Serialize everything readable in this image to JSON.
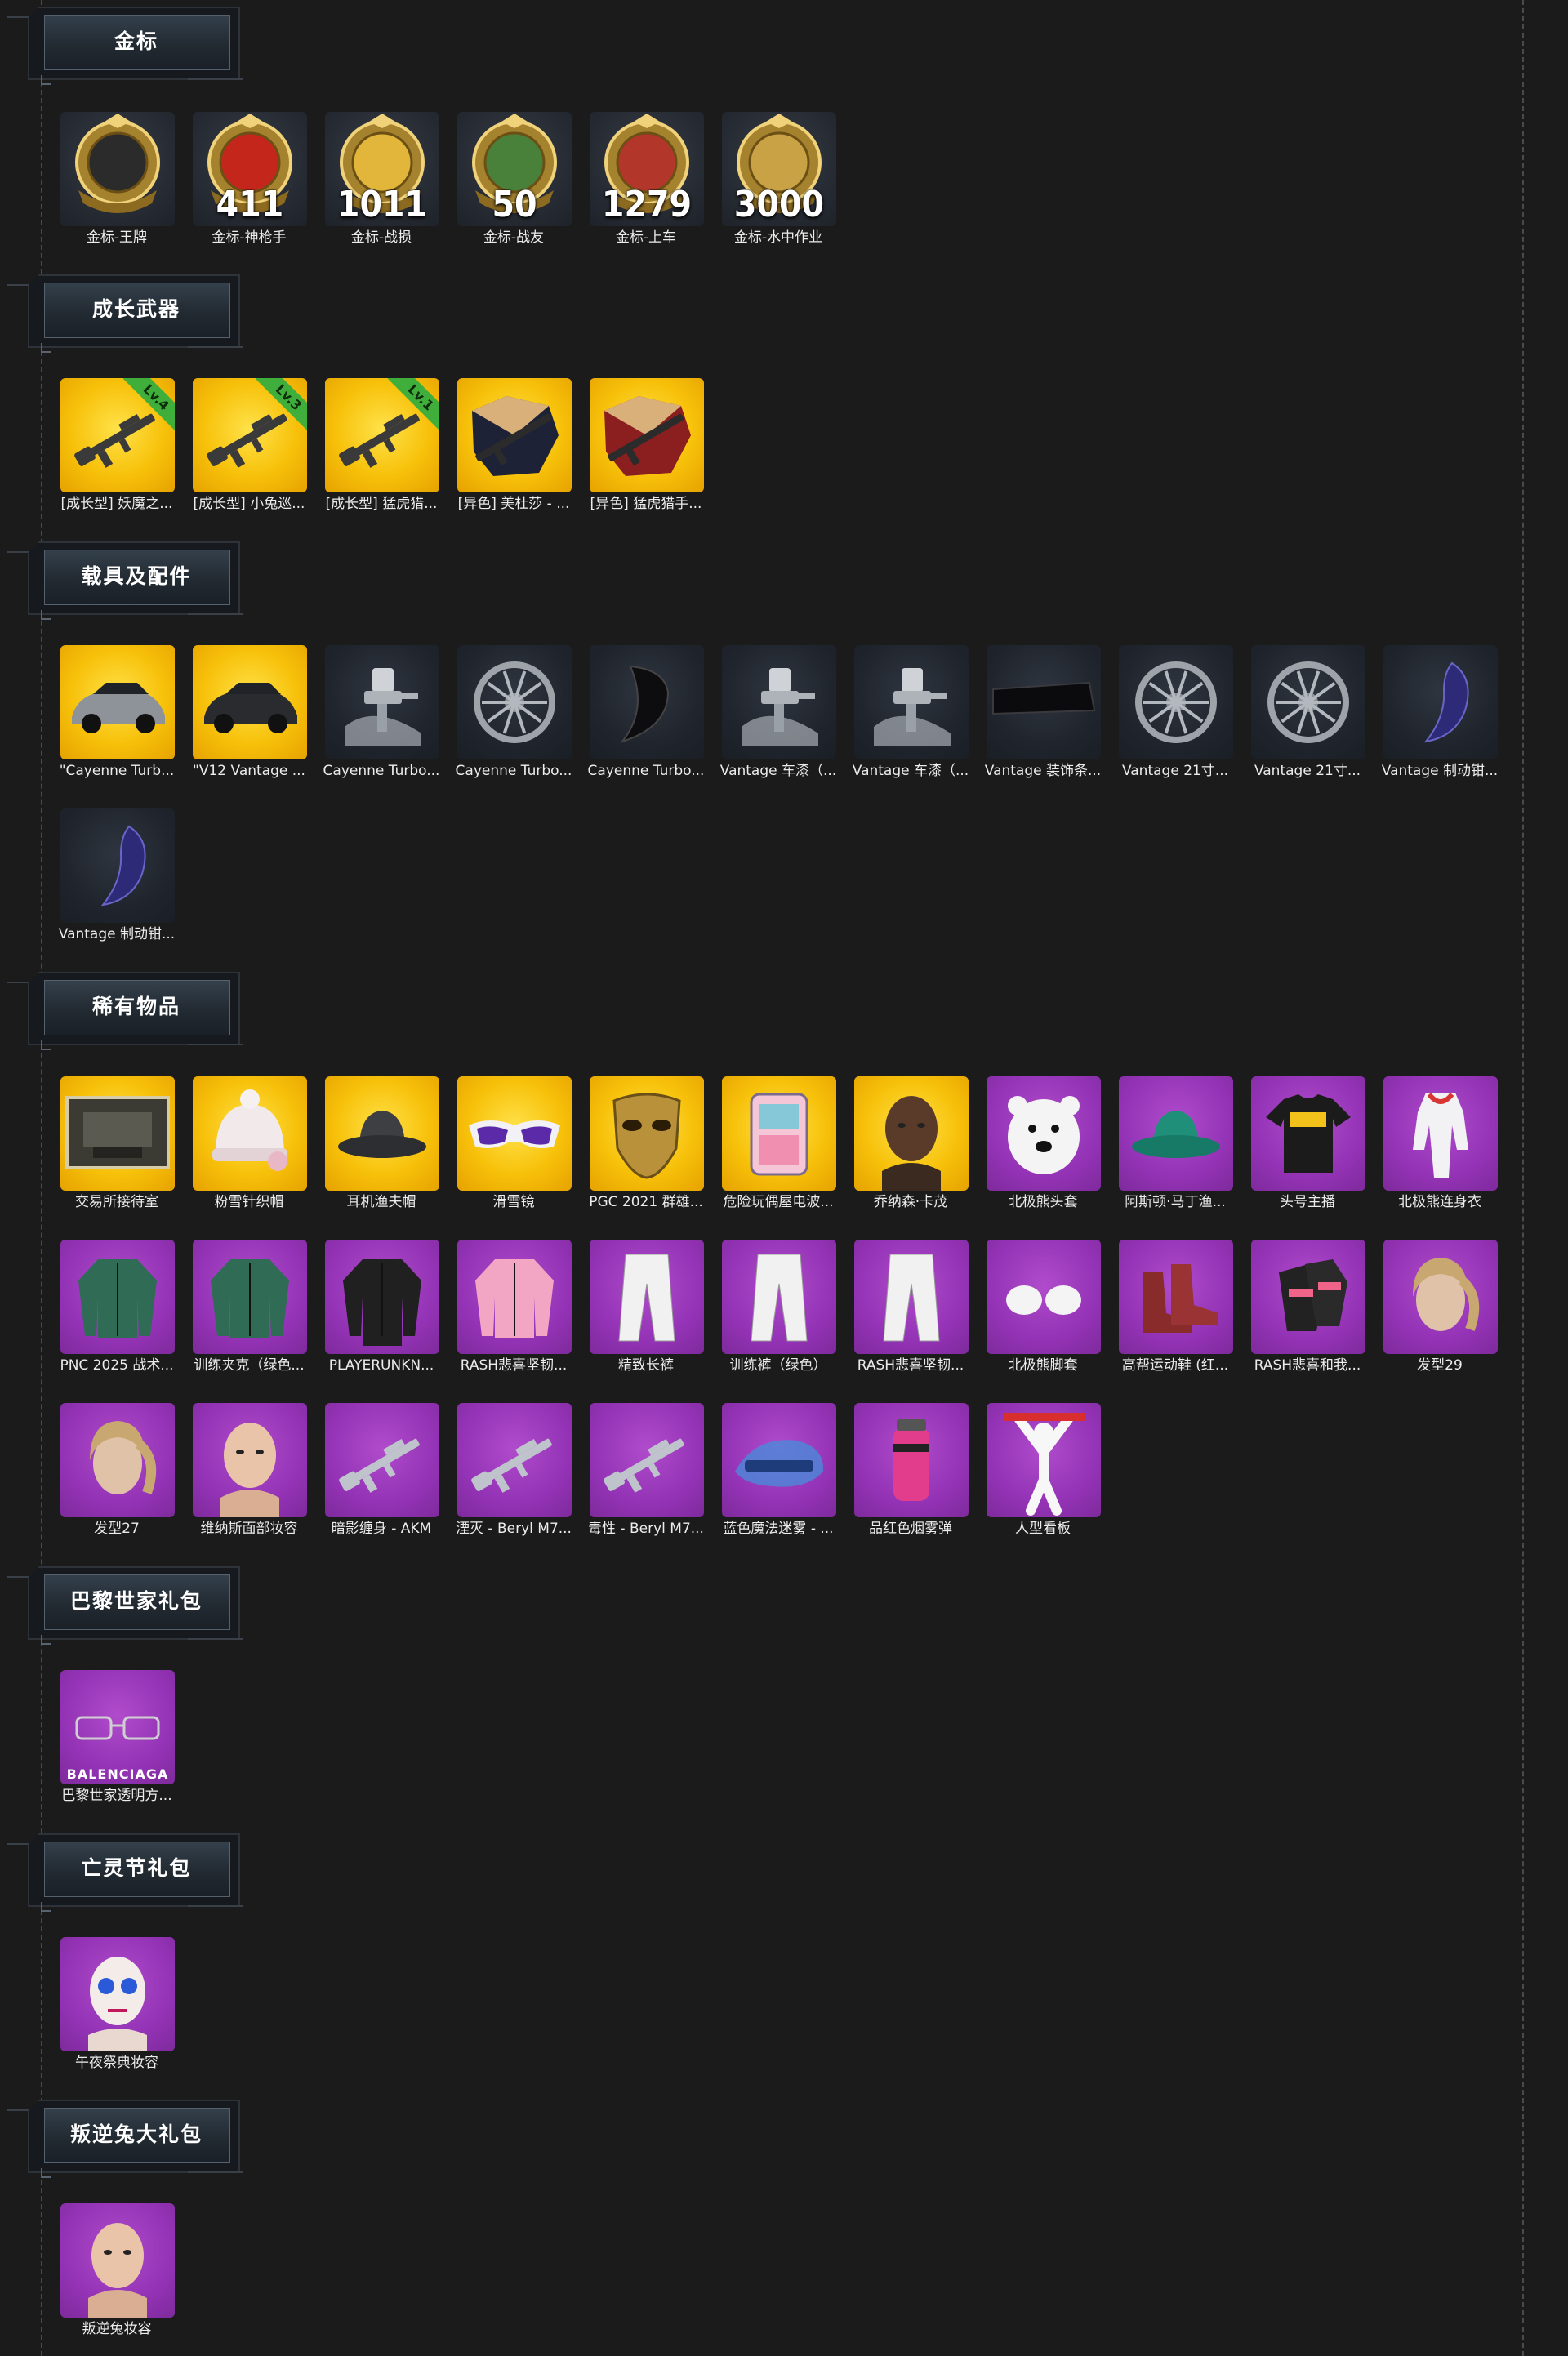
{
  "sections": [
    {
      "title": "金标",
      "items": [
        {
          "label": "金标-王牌",
          "icon": "ace-emblem-icon",
          "tile": "emblem",
          "value": ""
        },
        {
          "label": "金标-神枪手",
          "icon": "sharpshooter-emblem-icon",
          "tile": "emblem",
          "value": "411"
        },
        {
          "label": "金标-战损",
          "icon": "battle-damage-emblem-icon",
          "tile": "emblem",
          "value": "1011"
        },
        {
          "label": "金标-战友",
          "icon": "comrade-emblem-icon",
          "tile": "emblem",
          "value": "50"
        },
        {
          "label": "金标-上车",
          "icon": "car-emblem-icon",
          "tile": "emblem",
          "value": "1279"
        },
        {
          "label": "金标-水中作业",
          "icon": "seal-emblem-icon",
          "tile": "emblem",
          "value": "3000"
        }
      ]
    },
    {
      "title": "成长武器",
      "items": [
        {
          "label": "[成长型] 妖魔之...",
          "icon": "rifle-icon",
          "tile": "gold",
          "level": "Lv.4"
        },
        {
          "label": "[成长型] 小兔巡...",
          "icon": "rifle-icon",
          "tile": "gold",
          "level": "Lv.3"
        },
        {
          "label": "[成长型] 猛虎猎...",
          "icon": "shotgun-icon",
          "tile": "gold",
          "level": "Lv.1"
        },
        {
          "label": "[异色] 美杜莎 - ...",
          "icon": "rifle-map-icon",
          "tile": "gold"
        },
        {
          "label": "[异色] 猛虎猎手...",
          "icon": "shotgun-map-icon",
          "tile": "gold"
        }
      ]
    },
    {
      "title": "载具及配件",
      "items": [
        {
          "label": "\"Cayenne Turb...",
          "icon": "suv-car-icon",
          "tile": "gold"
        },
        {
          "label": "\"V12 Vantage ...",
          "icon": "sports-car-icon",
          "tile": "gold"
        },
        {
          "label": "Cayenne Turbo...",
          "icon": "spray-gun-icon",
          "tile": "dark"
        },
        {
          "label": "Cayenne Turbo...",
          "icon": "wheel-rim-icon",
          "tile": "dark"
        },
        {
          "label": "Cayenne Turbo...",
          "icon": "car-trim-icon",
          "tile": "dark"
        },
        {
          "label": "Vantage 车漆（...",
          "icon": "spray-gun-icon",
          "tile": "dark"
        },
        {
          "label": "Vantage 车漆（...",
          "icon": "spray-gun-icon",
          "tile": "dark"
        },
        {
          "label": "Vantage 装饰条...",
          "icon": "trim-strip-icon",
          "tile": "dark"
        },
        {
          "label": "Vantage 21寸...",
          "icon": "wheel-rim-icon",
          "tile": "dark"
        },
        {
          "label": "Vantage 21寸...",
          "icon": "wheel-rim-icon",
          "tile": "dark"
        },
        {
          "label": "Vantage 制动钳...",
          "icon": "brake-caliper-icon",
          "tile": "dark"
        },
        {
          "label": "Vantage 制动钳...",
          "icon": "brake-caliper-icon",
          "tile": "dark"
        }
      ]
    },
    {
      "title": "稀有物品",
      "items": [
        {
          "label": "交易所接待室",
          "icon": "room-icon",
          "tile": "gold"
        },
        {
          "label": "粉雪针织帽",
          "icon": "beanie-icon",
          "tile": "gold"
        },
        {
          "label": "耳机渔夫帽",
          "icon": "bucket-hat-icon",
          "tile": "gold"
        },
        {
          "label": "滑雪镜",
          "icon": "goggles-icon",
          "tile": "gold"
        },
        {
          "label": "PGC 2021 群雄...",
          "icon": "mask-icon",
          "tile": "gold"
        },
        {
          "label": "危险玩偶屋电波...",
          "icon": "backpack-icon",
          "tile": "gold"
        },
        {
          "label": "乔纳森·卡茂",
          "icon": "face-icon",
          "tile": "gold"
        },
        {
          "label": "北极熊头套",
          "icon": "bear-head-icon",
          "tile": "purple"
        },
        {
          "label": "阿斯顿·马丁渔...",
          "icon": "bucket-hat-icon",
          "tile": "purple"
        },
        {
          "label": "头号主播",
          "icon": "tshirt-icon",
          "tile": "purple"
        },
        {
          "label": "北极熊连身衣",
          "icon": "jumpsuit-icon",
          "tile": "purple"
        },
        {
          "label": "PNC 2025 战术...",
          "icon": "jacket-icon",
          "tile": "purple"
        },
        {
          "label": "训练夹克（绿色...",
          "icon": "jacket-icon",
          "tile": "purple"
        },
        {
          "label": "PLAYERUNKN...",
          "icon": "coat-icon",
          "tile": "purple"
        },
        {
          "label": "RASH悲喜坚韧...",
          "icon": "hoodie-icon",
          "tile": "purple"
        },
        {
          "label": "精致长裤",
          "icon": "pants-icon",
          "tile": "purple"
        },
        {
          "label": "训练裤（绿色）",
          "icon": "pants-icon",
          "tile": "purple"
        },
        {
          "label": "RASH悲喜坚韧...",
          "icon": "pants-icon",
          "tile": "purple"
        },
        {
          "label": "北极熊脚套",
          "icon": "paws-icon",
          "tile": "purple"
        },
        {
          "label": "高帮运动鞋 (红...",
          "icon": "shoes-icon",
          "tile": "purple"
        },
        {
          "label": "RASH悲喜和我...",
          "icon": "gloves-icon",
          "tile": "purple"
        },
        {
          "label": "发型29",
          "icon": "hair-icon",
          "tile": "purple"
        },
        {
          "label": "发型27",
          "icon": "hair-icon",
          "tile": "purple"
        },
        {
          "label": "维纳斯面部妆容",
          "icon": "face-icon",
          "tile": "purple"
        },
        {
          "label": "暗影缠身 - AKM",
          "icon": "rifle-icon",
          "tile": "purple"
        },
        {
          "label": "湮灭 - Beryl M7...",
          "icon": "rifle-icon",
          "tile": "purple"
        },
        {
          "label": "毒性 - Beryl M7...",
          "icon": "rifle-icon",
          "tile": "purple"
        },
        {
          "label": "蓝色魔法迷雾 - ...",
          "icon": "gun-skin-icon",
          "tile": "purple"
        },
        {
          "label": "品红色烟雾弹",
          "icon": "smoke-grenade-icon",
          "tile": "purple"
        },
        {
          "label": "人型看板",
          "icon": "mannequin-icon",
          "tile": "purple"
        }
      ]
    },
    {
      "title": "巴黎世家礼包",
      "items": [
        {
          "label": "巴黎世家透明方...",
          "icon": "glasses-icon",
          "tile": "purple",
          "brand": "BALENCIAGA"
        }
      ]
    },
    {
      "title": "亡灵节礼包",
      "items": [
        {
          "label": "午夜祭典妆容",
          "icon": "skull-face-icon",
          "tile": "purple"
        }
      ]
    },
    {
      "title": "叛逆兔大礼包",
      "items": [
        {
          "label": "叛逆兔妆容",
          "icon": "face-icon",
          "tile": "purple"
        }
      ]
    }
  ],
  "colors": {
    "background": "#1b1b1c",
    "gold": "#f7c10a",
    "purple": "#9433b6",
    "dark": "#20252d",
    "level_badge": "#3fae3a"
  }
}
